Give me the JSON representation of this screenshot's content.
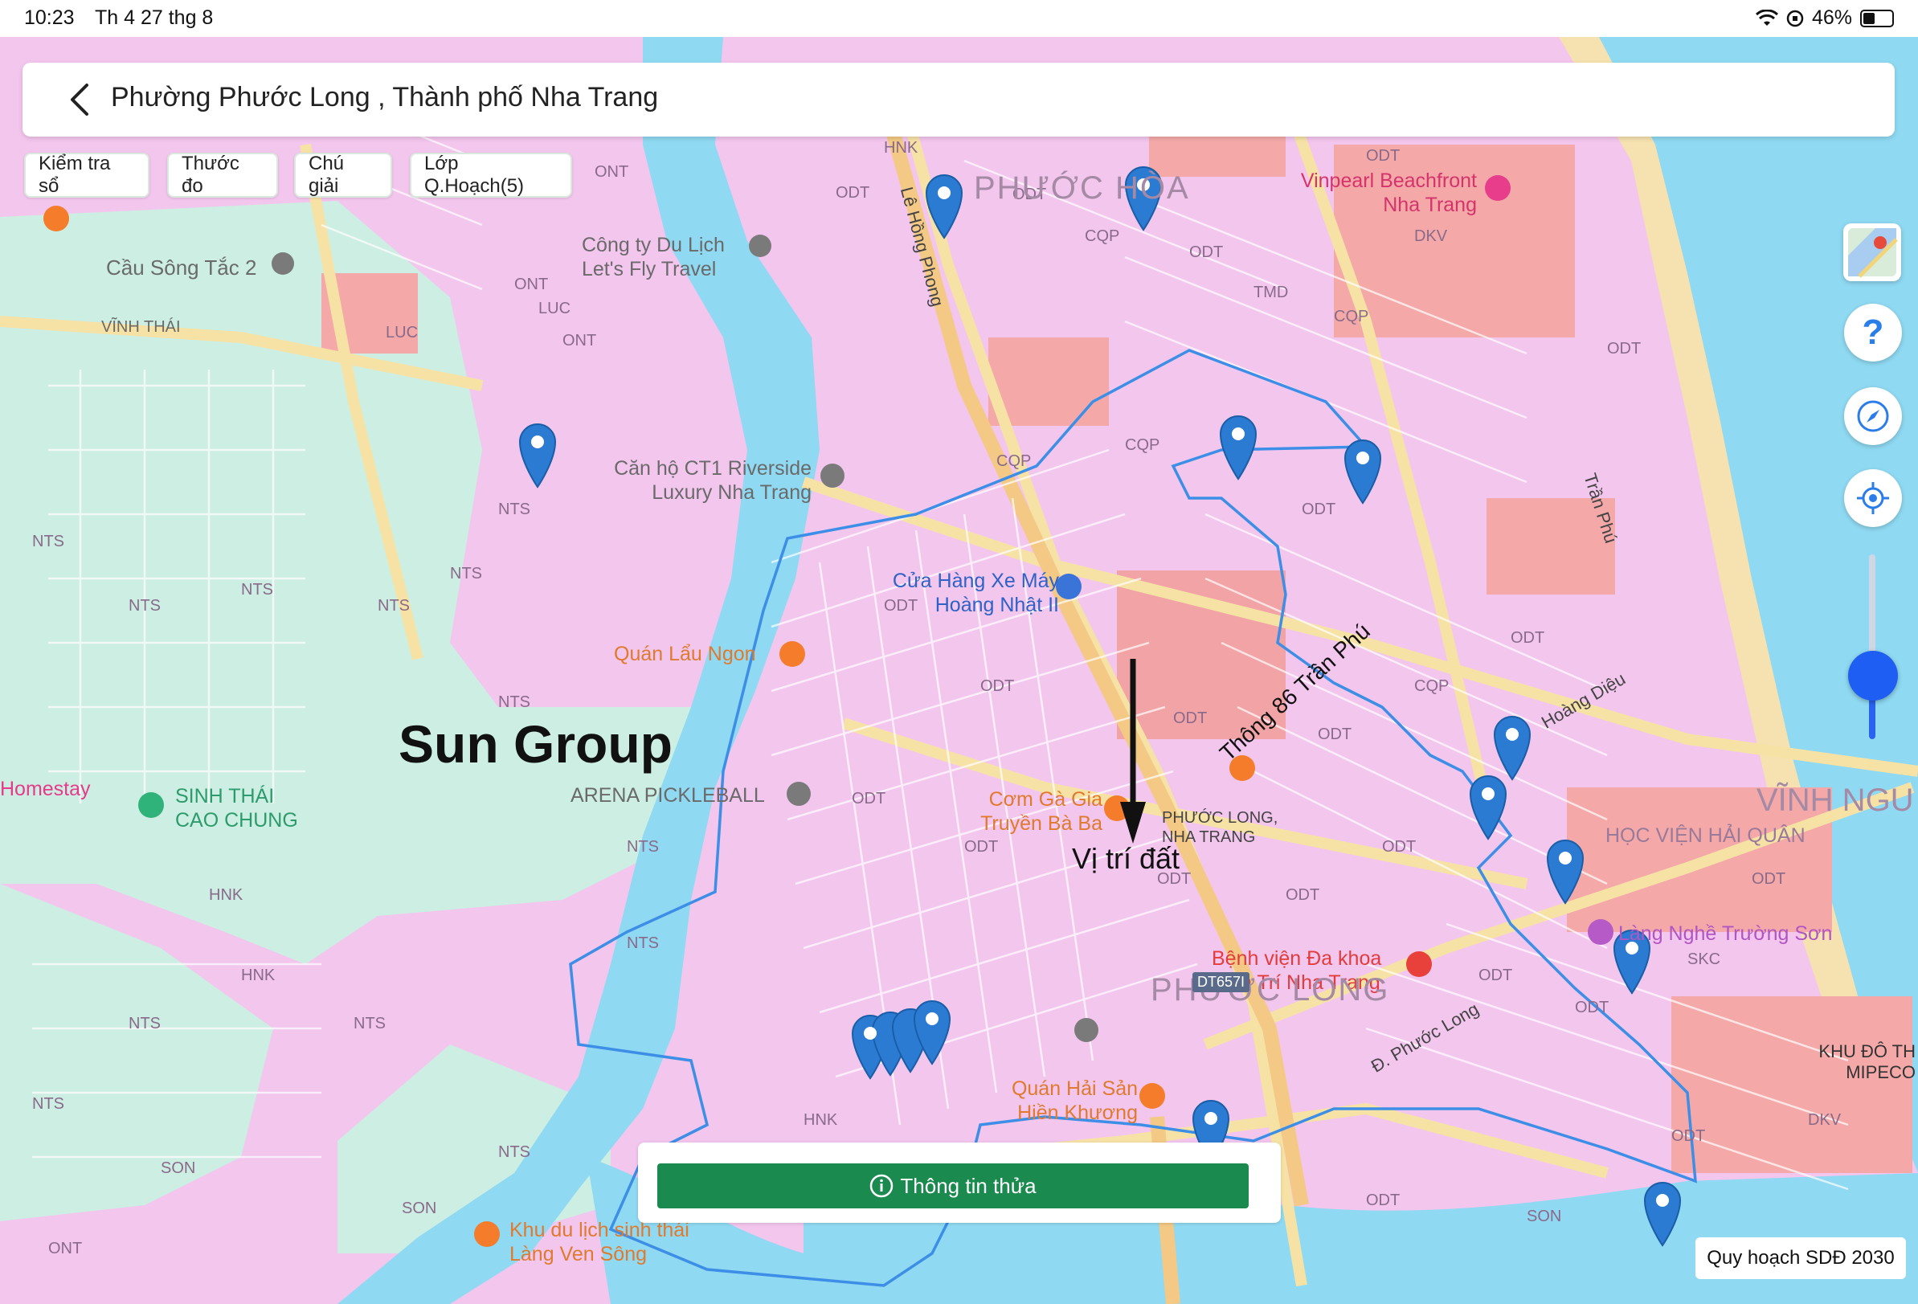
{
  "status_bar": {
    "time": "10:23",
    "date": "Th 4 27 thg 8",
    "battery": "46%"
  },
  "header": {
    "title": "Phường Phước Long , Thành phố Nha Trang"
  },
  "chips": [
    "Kiểm tra sổ",
    "Thước đo",
    "Chú giải",
    "Lớp Q.Hoạch(5)"
  ],
  "controls": {
    "help": "?",
    "zoom_level": 0.35
  },
  "bottom": {
    "info_button": "Thông tin thửa",
    "plan_badge": "Quy hoạch SDĐ 2030"
  },
  "annotations": {
    "sun_group": "Sun Group",
    "land_position": "Vị trí đất",
    "alley": "Thông 86 Trần Phú"
  },
  "places": {
    "vinpearl": "Vinpearl Beachfront Nha Trang",
    "riverside": "Căn hộ CT1 Riverside Luxury Nha Trang",
    "travel": "Công ty Du Lịch Let's Fly Travel",
    "cau_song_tac": "Cầu Sông Tắc 2",
    "xe_may": "Cửa Hàng Xe Máy Hoàng Nhật II",
    "lau": "Quán Lẩu Ngon",
    "pickleball": "ARENA PICKLEBALL",
    "sinh_thai": "SINH THÁI CAO CHUNG",
    "homestay": "Homestay",
    "com_ga": "Cơm Gà Gia Truyền Bà Ba",
    "benh_vien": "Bệnh viện Đa khoa Tâm Trí Nha Trang",
    "hai_san": "Quán Hải Sản Hiền Khương",
    "khu_du_lich": "Khu du lịch sinh thái Làng Ven Sông",
    "truong_son": "Làng Nghề Trường Sơn",
    "hoc_vien": "HỌC VIỆN HẢI QUÂN",
    "vinh_nguyen": "VĨNH NGU",
    "phuoc_hoa": "PHƯỚC HÒA",
    "phuoc_long": "PHƯỚC LONG",
    "phuoc_long_nt": "PHƯỚC LONG, NHA TRANG",
    "mipeco": "KHU ĐÔ TH MIPECO",
    "vinh_thai": "VĨNH THÁI",
    "tran_phu": "Trần Phú",
    "hoang_dieu": "Hoàng Diệu",
    "le_hong_phong": "Lê Hồng Phong",
    "phuoc_long_road": "Đ. Phước Long",
    "dt657": "DT657I"
  },
  "colors": {
    "residential": "#f3c6ee",
    "water": "#8fd9f2",
    "green": "#cdeee2",
    "commercial": "#f4a9a8",
    "road": "#f7e4b0",
    "boundary": "#3d8ee6",
    "pin": "#2c7bd3",
    "button": "#1b8a4f"
  }
}
